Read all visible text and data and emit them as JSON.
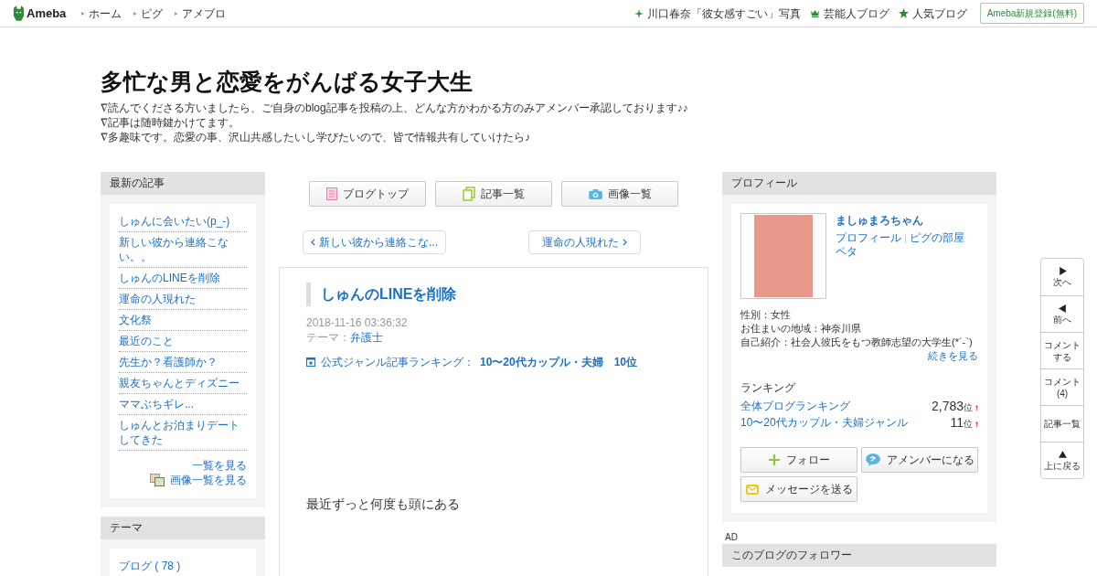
{
  "header": {
    "logo": "Ameba",
    "nav": [
      "ホーム",
      "ピグ",
      "アメブロ"
    ],
    "links": [
      {
        "label": "川口春奈「彼女感すごい」写真",
        "kind": "sparkle"
      },
      {
        "label": "芸能人ブログ",
        "kind": "crown"
      },
      {
        "label": "人気ブログ",
        "kind": "star"
      }
    ],
    "register": "Ameba新規登録(無料)"
  },
  "blog": {
    "title": "多忙な男と恋愛をがんばる女子大生",
    "description": [
      "∇読んでくださる方いましたら、ご自身のblog記事を投稿の上、どんな方かわかる方のみアメンバー承認しております♪♪",
      "∇記事は随時鍵かけてます。",
      "∇多趣味です。恋愛の事、沢山共感したいし学びたいので、皆で情報共有していけたら♪"
    ]
  },
  "recent": {
    "heading": "最新の記事",
    "items": [
      "しゅんに会いたい(p_-)",
      "新しい彼から連絡こない。。",
      "しゅんのLINEを削除",
      "運命の人現れた",
      "文化祭",
      "最近のこと",
      "先生か？看護師か？",
      "親友ちゃんとディズニー",
      "ママぶちギレ...",
      "しゅんとお泊まりデートしてきた"
    ],
    "more_link": "一覧を見る",
    "images_link": "画像一覧を見る"
  },
  "theme": {
    "heading": "テーマ",
    "items": [
      "ブログ ( 78 )"
    ]
  },
  "toolbar": [
    {
      "label": "ブログトップ",
      "kind": "top"
    },
    {
      "label": "記事一覧",
      "kind": "list"
    },
    {
      "label": "画像一覧",
      "kind": "camera"
    }
  ],
  "pager": {
    "prev": "新しい彼から連絡こな...",
    "next": "運命の人現れた"
  },
  "article": {
    "title": "しゅんのLINEを削除",
    "date": "2018-11-16 03:36:32",
    "theme_label": "テーマ：",
    "theme": "弁護士",
    "ranking_label": "公式ジャンル記事ランキング：",
    "ranking_value": "10〜20代カップル・夫婦　10位",
    "body": "最近ずっと何度も頭にある"
  },
  "profile": {
    "heading": "プロフィール",
    "name": "ましゅまろちゃん",
    "links": [
      "プロフィール",
      "ピグの部屋"
    ],
    "peta": "ペタ",
    "details": [
      "性別：女性",
      "お住まいの地域：神奈川県",
      "自己紹介：社会人彼氏をもつ教師志望の大学生(*´-`)"
    ],
    "more": "続きを見る",
    "ranking_heading": "ランキング",
    "rankings": [
      {
        "label": "全体ブログランキング",
        "rank": "2,783",
        "unit": "位"
      },
      {
        "label": "10〜20代カップル・夫婦ジャンル",
        "rank": "11",
        "unit": "位"
      }
    ],
    "buttons": [
      {
        "label": "フォロー",
        "kind": "follow"
      },
      {
        "label": "アメンバーになる",
        "kind": "amember"
      },
      {
        "label": "メッセージを送る",
        "kind": "message"
      }
    ]
  },
  "ad_label": "AD",
  "followers": {
    "heading": "このブログのフォロワー"
  },
  "side_nav": [
    {
      "label": "次へ",
      "kind": "next"
    },
    {
      "label": "前へ",
      "kind": "prev"
    },
    {
      "label": "コメントする",
      "kind": "text"
    },
    {
      "label": "コメント(4)",
      "kind": "text"
    },
    {
      "label": "記事一覧",
      "kind": "text"
    },
    {
      "label": "上に戻る",
      "kind": "top"
    }
  ]
}
